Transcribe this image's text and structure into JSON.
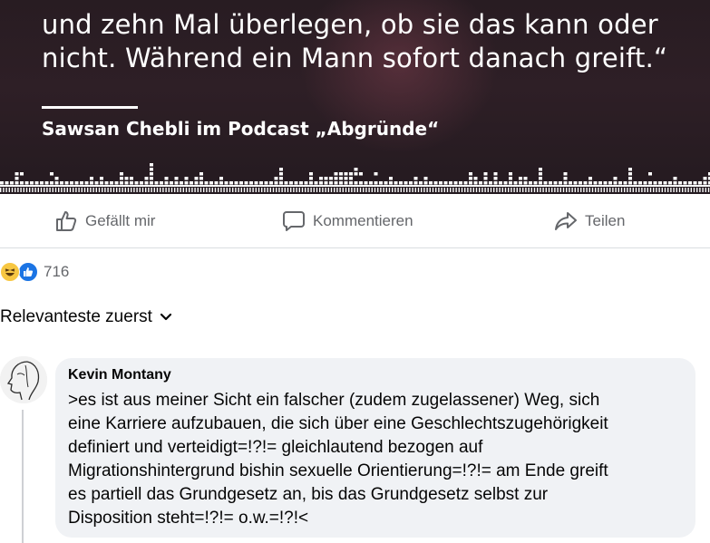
{
  "post": {
    "quote_lines": [
      "und zehn Mal überlegen, ob sie das kann oder",
      "nicht. Während ein Mann sofort danach greift.“"
    ],
    "source": "Sawsan Chebli im Podcast „Abgründe“"
  },
  "actions": {
    "like_label": "Gefällt mir",
    "comment_label": "Kommentieren",
    "share_label": "Teilen"
  },
  "reactions": {
    "icons": [
      "haha-reaction-icon",
      "like-reaction-icon"
    ],
    "count": "716"
  },
  "sort": {
    "label": "Relevanteste zuerst"
  },
  "comment": {
    "author": "Kevin Montany",
    "lines": [
      ">es ist aus meiner Sicht ein falscher (zudem zugelassener)  Weg, sich",
      "eine Karriere aufzubauen, die sich über eine Geschlechtszugehörigkeit",
      "definiert und verteidigt=!?!= gleichlautend bezogen auf",
      "Migrationshintergrund bishin sexuelle Orientierung=!?!= am Ende greift",
      "es partiell das Grundgesetz an, bis das Grundgesetz selbst zur",
      "Disposition steht=!?!=  o.w.=!?!<"
    ]
  },
  "colors": {
    "image_background": "#2a1d23",
    "muted_text": "#65676b",
    "bubble_background": "#f0f2f5",
    "like_blue": "#1b74e4",
    "haha_yellow": "#f7c742"
  }
}
